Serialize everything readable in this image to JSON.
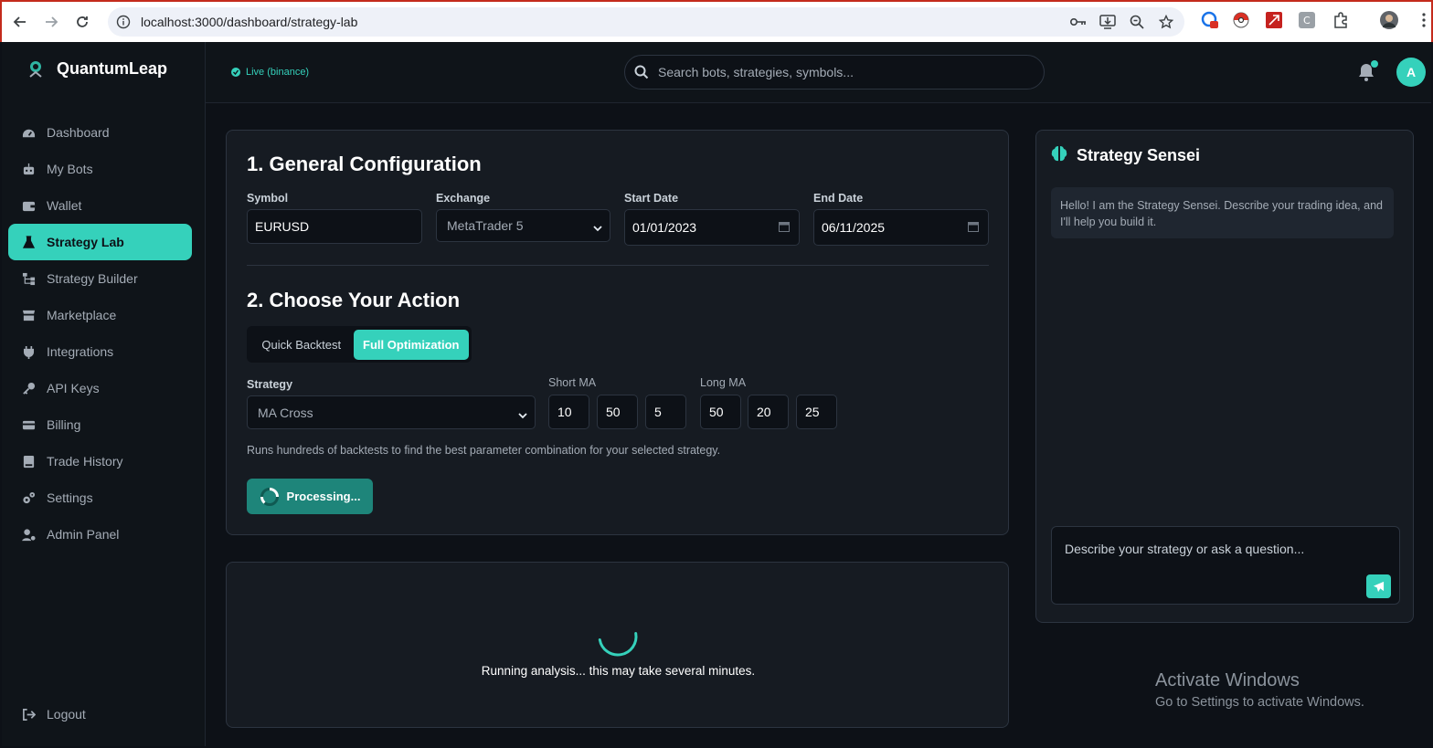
{
  "browser": {
    "url": "localhost:3000/dashboard/strategy-lab"
  },
  "brand": {
    "name": "QuantumLeap"
  },
  "sidebar": {
    "items": [
      {
        "label": "Dashboard",
        "icon": "dashboard-icon"
      },
      {
        "label": "My Bots",
        "icon": "robot-icon"
      },
      {
        "label": "Wallet",
        "icon": "wallet-icon"
      },
      {
        "label": "Strategy Lab",
        "icon": "flask-icon",
        "active": true
      },
      {
        "label": "Strategy Builder",
        "icon": "sitemap-icon"
      },
      {
        "label": "Marketplace",
        "icon": "store-icon"
      },
      {
        "label": "Integrations",
        "icon": "plug-icon"
      },
      {
        "label": "API Keys",
        "icon": "key-icon"
      },
      {
        "label": "Billing",
        "icon": "credit-card-icon"
      },
      {
        "label": "Trade History",
        "icon": "book-icon"
      },
      {
        "label": "Settings",
        "icon": "gears-icon"
      },
      {
        "label": "Admin Panel",
        "icon": "user-gear-icon"
      }
    ],
    "logout": "Logout"
  },
  "topbar": {
    "status": "Live (binance)",
    "search_placeholder": "Search bots, strategies, symbols...",
    "avatar_initial": "A"
  },
  "config": {
    "section1_title": "1. General Configuration",
    "symbol_label": "Symbol",
    "symbol_value": "EURUSD",
    "exchange_label": "Exchange",
    "exchange_value": "MetaTrader 5",
    "start_label": "Start Date",
    "start_value": "01/01/2023",
    "end_label": "End Date",
    "end_value": "06/11/2025",
    "section2_title": "2. Choose Your Action",
    "mode_quick": "Quick Backtest",
    "mode_full": "Full Optimization",
    "strategy_label": "Strategy",
    "strategy_value": "MA Cross",
    "short_ma_label": "Short MA",
    "short_ma": [
      "10",
      "50",
      "5"
    ],
    "long_ma_label": "Long MA",
    "long_ma": [
      "50",
      "20",
      "25"
    ],
    "description": "Runs hundreds of backtests to find the best parameter combination for your selected strategy.",
    "process_label": "Processing..."
  },
  "results": {
    "message": "Running analysis... this may take several minutes."
  },
  "sensei": {
    "title": "Strategy Sensei",
    "greeting": "Hello! I am the Strategy Sensei. Describe your trading idea, and I'll help you build it.",
    "input_placeholder": "Describe your strategy or ask a question..."
  },
  "watermark": {
    "line1": "Activate Windows",
    "line2": "Go to Settings to activate Windows."
  },
  "colors": {
    "accent": "#35d1bb",
    "background": "#0d1117",
    "panel": "#161b22"
  }
}
